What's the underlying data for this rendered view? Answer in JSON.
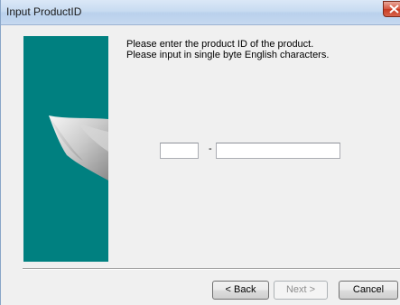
{
  "window": {
    "title": "Input ProductID"
  },
  "instructions": {
    "line1": "Please enter the product ID of the product.",
    "line2": "Please input in single byte English characters."
  },
  "product_id": {
    "part1_value": "",
    "separator": "-",
    "part2_value": ""
  },
  "buttons": {
    "back": "< Back",
    "next": "Next >",
    "cancel": "Cancel"
  },
  "colors": {
    "side_panel": "#008080",
    "close_button": "#c83a22"
  },
  "icons": {
    "close": "close-icon",
    "side_art": "page-curl-graphic"
  }
}
